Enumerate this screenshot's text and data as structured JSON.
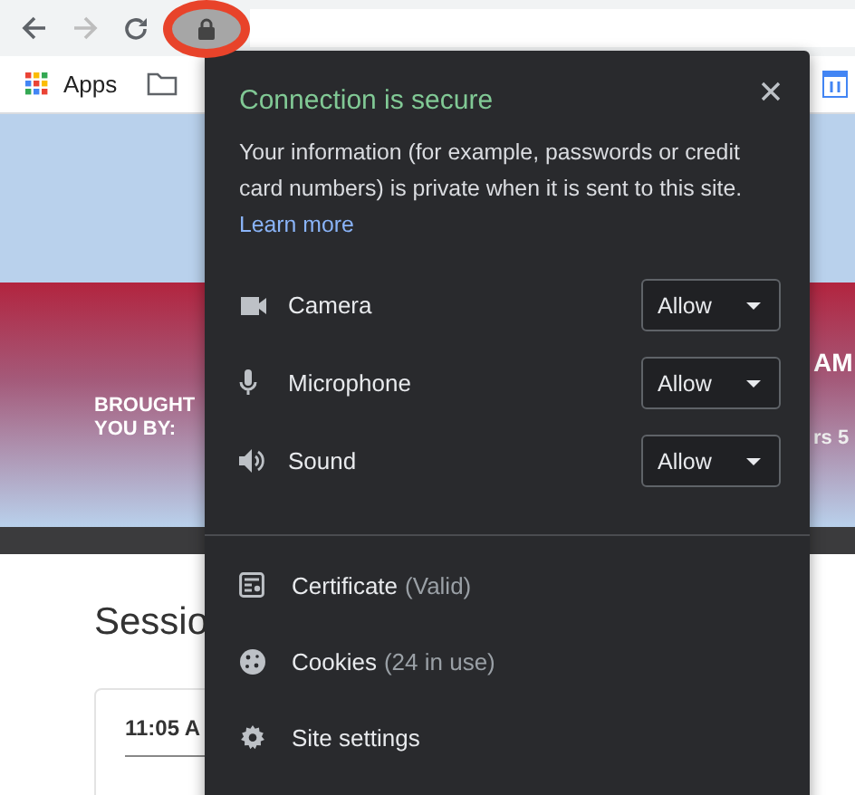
{
  "toolbar": {
    "bookmarks": [
      {
        "label": "Apps"
      }
    ]
  },
  "page": {
    "banner_left": "BROUGHT YOU BY:",
    "banner_right_top": "AM",
    "banner_right_bottom": "rs 5",
    "heading": "Sessio",
    "card_time": "11:05 A"
  },
  "popup": {
    "title": "Connection is secure",
    "description": "Your information (for example, passwords or credit card numbers) is private when it is sent to this site.",
    "link": "Learn more",
    "permissions": [
      {
        "kind": "camera",
        "label": "Camera",
        "value": "Allow"
      },
      {
        "kind": "microphone",
        "label": "Microphone",
        "value": "Allow"
      },
      {
        "kind": "sound",
        "label": "Sound",
        "value": "Allow"
      }
    ],
    "items": [
      {
        "kind": "certificate",
        "label": "Certificate",
        "note": "(Valid)"
      },
      {
        "kind": "cookies",
        "label": "Cookies",
        "note": "(24 in use)"
      },
      {
        "kind": "settings",
        "label": "Site settings"
      }
    ]
  }
}
